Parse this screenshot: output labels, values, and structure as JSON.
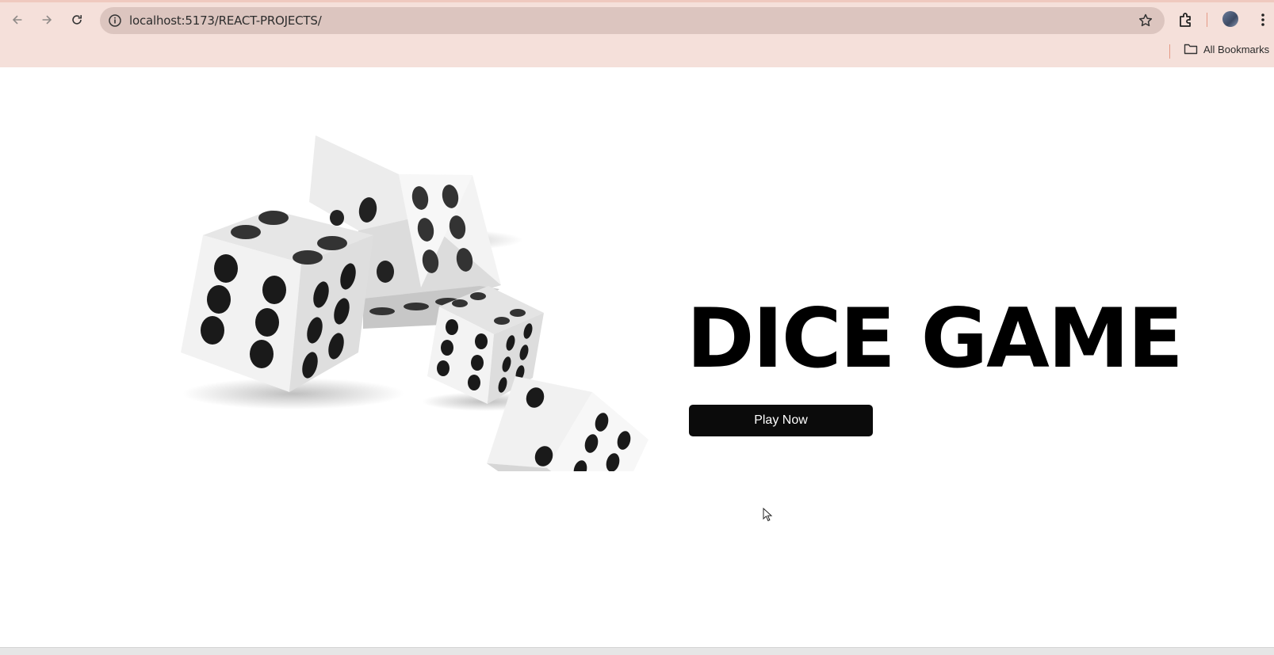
{
  "browser": {
    "url": "localhost:5173/REACT-PROJECTS/",
    "bookmarks_label": "All Bookmarks",
    "icons": [
      "back-icon",
      "forward-icon",
      "reload-icon",
      "info-icon",
      "star-icon",
      "extensions-icon",
      "profile-avatar",
      "menu-icon",
      "folder-icon"
    ]
  },
  "hero": {
    "title": "DICE GAME",
    "button_label": "Play Now"
  },
  "colors": {
    "chrome_bg": "#f5e0da",
    "omnibox_bg": "#dcc5bf",
    "button_bg": "#0b0b0b",
    "title": "#000000"
  }
}
